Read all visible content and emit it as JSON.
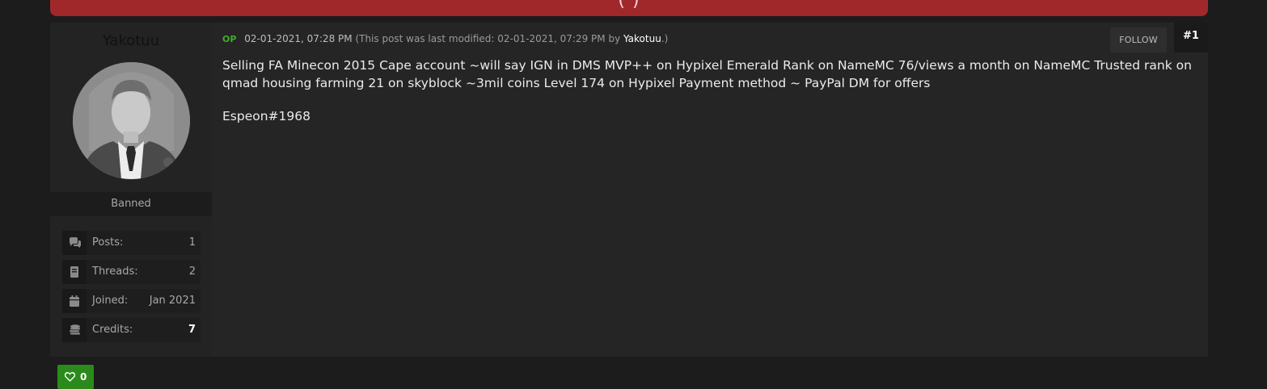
{
  "banner": {
    "text": "(  )"
  },
  "post": {
    "username": "Yakotuu",
    "usergroup": "Banned",
    "stats": [
      {
        "label": "Posts:",
        "value": "1",
        "icon": "comments-icon"
      },
      {
        "label": "Threads:",
        "value": "2",
        "icon": "book-icon"
      },
      {
        "label": "Joined:",
        "value": "Jan 2021",
        "icon": "calendar-icon"
      },
      {
        "label": "Credits:",
        "value": "7",
        "icon": "coins-icon"
      }
    ],
    "op_badge": "OP",
    "date": "02-01-2021, 07:28 PM",
    "modified_prefix": "(This post was last modified: 02-01-2021, 07:29 PM by",
    "modified_user": "Yakotuu",
    "modified_suffix": ".)",
    "follow_label": "FOLLOW",
    "post_number": "#1",
    "body_lines": [
      "Selling FA Minecon 2015 Cape account ~will say IGN in DMS MVP++ on Hypixel Emerald Rank on NameMC 76/views a month on NameMC Trusted rank on qmad housing farming 21 on skyblock ~3mil coins Level 174 on Hypixel Payment method ~ PayPal DM for offers",
      "Espeon#1968"
    ],
    "like_count": "0"
  },
  "colors": {
    "banner": "#a0282b",
    "accent_green": "#2b8a1c",
    "op_green": "#3fae2a"
  }
}
